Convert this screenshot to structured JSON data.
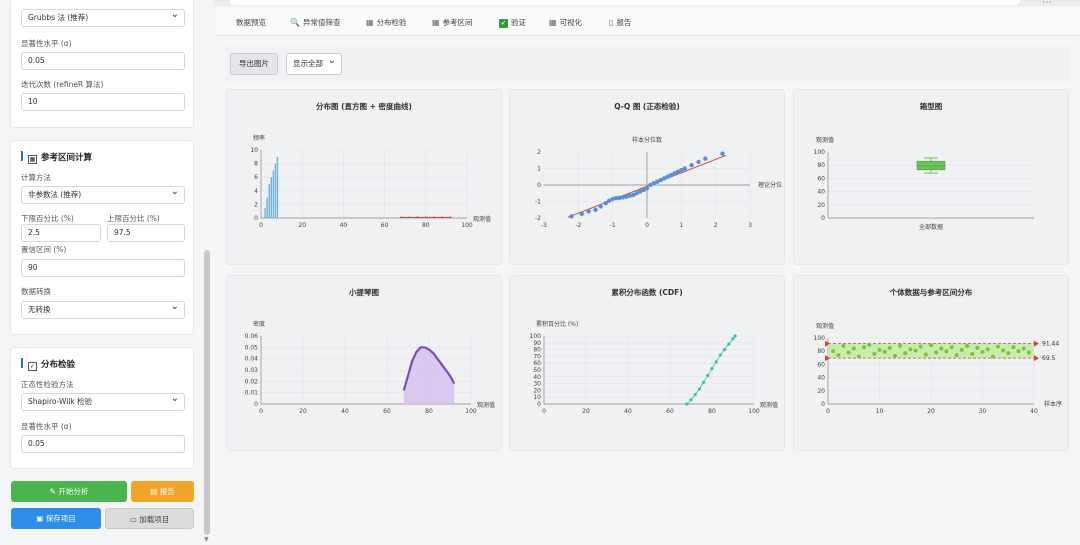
{
  "sidebar": {
    "outlier_method_value": "Grubbs 法 (推荐)",
    "sig_label_1": "显著性水平 (α)",
    "sig_value_1": "0.05",
    "iter_label": "迭代次数 (refineR 算法)",
    "iter_value": "10",
    "ri_title": "参考区间计算",
    "calc_method_label": "计算方法",
    "calc_method_value": "非参数法 (推荐)",
    "lower_pct_label": "下限百分比 (%)",
    "lower_pct_value": "2.5",
    "upper_pct_label": "上限百分比 (%)",
    "upper_pct_value": "97.5",
    "ci_label": "置信区间 (%)",
    "ci_value": "90",
    "transform_label": "数据转换",
    "transform_value": "无转换",
    "dist_title": "分布检验",
    "normtest_label": "正态性检验方法",
    "normtest_value": "Shapiro-Wilk 检验",
    "sig_label_2": "显著性水平 (α)",
    "sig_value_2": "0.05",
    "btn_start": "开始分析",
    "btn_report": "报告",
    "btn_save": "保存项目",
    "btn_load": "加载项目"
  },
  "tabs": [
    {
      "label": "数据预览",
      "icon": ""
    },
    {
      "label": "异常值筛查",
      "icon": "search-icon"
    },
    {
      "label": "分布检验",
      "icon": "chart-icon"
    },
    {
      "label": "参考区间",
      "icon": "chart-icon"
    },
    {
      "label": "验证",
      "icon": "check-icon"
    },
    {
      "label": "可视化",
      "icon": "chart-icon"
    },
    {
      "label": "报告",
      "icon": "document-icon"
    }
  ],
  "toolbar": {
    "export_label": "导出图片",
    "display_value": "显示全部"
  },
  "chart_data": [
    {
      "type": "bar",
      "title": "分布图 (直方图 + 密度曲线)",
      "ylabel": "频率",
      "xlabel": "观测值",
      "xlim": [
        0,
        100
      ],
      "ylim": [
        0,
        10
      ],
      "xticks": [
        "0",
        "20",
        "40",
        "60",
        "80",
        "100"
      ],
      "yticks": [
        "0",
        "2",
        "4",
        "6",
        "8",
        "10"
      ],
      "bars": {
        "x": [
          2,
          3,
          4,
          5,
          6,
          7,
          8
        ],
        "values": [
          1.5,
          3,
          5,
          6,
          7,
          8,
          9
        ]
      },
      "density_curve": {
        "x": [
          68,
          72,
          76,
          80,
          84,
          88,
          92
        ],
        "values": [
          0.1,
          0.1,
          0.1,
          0.1,
          0.1,
          0.1,
          0.1
        ]
      }
    },
    {
      "type": "scatter",
      "title": "Q-Q 图 (正态检验)",
      "ylabel": "样本分位数",
      "xlabel": "理论分位",
      "xlim": [
        -3,
        3
      ],
      "ylim": [
        -2,
        2
      ],
      "xticks": [
        "-3",
        "-2",
        "-1",
        "0",
        "1",
        "2",
        "3"
      ],
      "yticks": [
        "-2",
        "-1",
        "0",
        "1",
        "2"
      ],
      "reference_line": {
        "x": [
          -2.3,
          2.3
        ],
        "y": [
          -1.95,
          1.8
        ]
      },
      "points": {
        "x": [
          -2.2,
          -1.9,
          -1.7,
          -1.5,
          -1.35,
          -1.2,
          -1.1,
          -1,
          -0.9,
          -0.8,
          -0.7,
          -0.6,
          -0.5,
          -0.4,
          -0.3,
          -0.2,
          -0.1,
          0,
          0.1,
          0.2,
          0.3,
          0.4,
          0.5,
          0.6,
          0.7,
          0.8,
          0.9,
          1,
          1.1,
          1.3,
          1.5,
          1.7,
          2.2
        ],
        "y": [
          -1.9,
          -1.75,
          -1.6,
          -1.5,
          -1.3,
          -1.1,
          -0.95,
          -0.85,
          -0.8,
          -0.78,
          -0.75,
          -0.7,
          -0.65,
          -0.6,
          -0.5,
          -0.4,
          -0.3,
          -0.2,
          0,
          0.1,
          0.2,
          0.3,
          0.4,
          0.5,
          0.6,
          0.7,
          0.8,
          0.9,
          1,
          1.2,
          1.4,
          1.6,
          1.9
        ]
      }
    },
    {
      "type": "box",
      "title": "箱型图",
      "ylabel": "观测值",
      "ylim": [
        0,
        100
      ],
      "yticks": [
        "0",
        "20",
        "40",
        "60",
        "80",
        "100"
      ],
      "categories": [
        "全部数据"
      ],
      "box": {
        "min": 68,
        "q1": 73,
        "median": 79,
        "q3": 86,
        "max": 91
      }
    },
    {
      "type": "area",
      "title": "小提琴图",
      "ylabel": "密度",
      "xlabel": "观测值",
      "xlim": [
        0,
        100
      ],
      "ylim": [
        0,
        0.06
      ],
      "xticks": [
        "0",
        "20",
        "40",
        "60",
        "80",
        "100"
      ],
      "yticks": [
        "0",
        "0.01",
        "0.02",
        "0.03",
        "0.04",
        "0.05",
        "0.06"
      ],
      "x": [
        68,
        70,
        72,
        74,
        76,
        78,
        80,
        82,
        84,
        86,
        88,
        90,
        92
      ],
      "values": [
        0.012,
        0.025,
        0.038,
        0.046,
        0.05,
        0.05,
        0.048,
        0.045,
        0.04,
        0.035,
        0.03,
        0.025,
        0.018
      ]
    },
    {
      "type": "line",
      "title": "累积分布函数 (CDF)",
      "ylabel": "累积百分比 (%)",
      "xlabel": "观测值",
      "xlim": [
        0,
        100
      ],
      "ylim": [
        0,
        100
      ],
      "xticks": [
        "0",
        "20",
        "40",
        "60",
        "80",
        "100"
      ],
      "yticks": [
        "0",
        "10",
        "20",
        "30",
        "40",
        "50",
        "60",
        "70",
        "80",
        "90",
        "100"
      ],
      "x": [
        68,
        70,
        72,
        74,
        76,
        78,
        80,
        82,
        84,
        86,
        88,
        90,
        91
      ],
      "values": [
        0,
        6,
        14,
        22,
        32,
        42,
        52,
        62,
        72,
        80,
        88,
        96,
        100
      ]
    },
    {
      "type": "scatter",
      "title": "个体数据与参考区间分布",
      "ylabel": "观测值",
      "xlabel": "样本序",
      "xlim": [
        0,
        40
      ],
      "ylim": [
        0,
        100
      ],
      "xticks": [
        "0",
        "10",
        "20",
        "30",
        "40"
      ],
      "yticks": [
        "0",
        "20",
        "40",
        "60",
        "80",
        "100"
      ],
      "upper_limit": 91.44,
      "lower_limit": 69.5,
      "upper_label": "91.44",
      "lower_label": "69.5",
      "points": {
        "x": [
          1,
          2,
          3,
          4,
          5,
          6,
          7,
          8,
          9,
          10,
          11,
          12,
          13,
          14,
          15,
          16,
          17,
          18,
          19,
          20,
          21,
          22,
          23,
          24,
          25,
          26,
          27,
          28,
          29,
          30,
          31,
          32,
          33,
          34,
          35,
          36,
          37,
          38,
          39
        ],
        "y": [
          80,
          74,
          88,
          78,
          84,
          72,
          86,
          90,
          76,
          82,
          79,
          85,
          73,
          88,
          77,
          83,
          81,
          87,
          75,
          89,
          78,
          84,
          80,
          86,
          74,
          82,
          88,
          76,
          85,
          79,
          83,
          72,
          87,
          81,
          77,
          86,
          80,
          84,
          78
        ]
      }
    }
  ],
  "colors": {
    "bar": "#6fb1d8",
    "qq_point": "#5b8fd4",
    "qq_line": "#c0504d",
    "box": "#6cc35a",
    "violin": "#7b4fae",
    "cdf": "#3bbfad",
    "ind_point": "#7ac143",
    "band": "#c8ebb0",
    "limit": "#d0423f"
  }
}
